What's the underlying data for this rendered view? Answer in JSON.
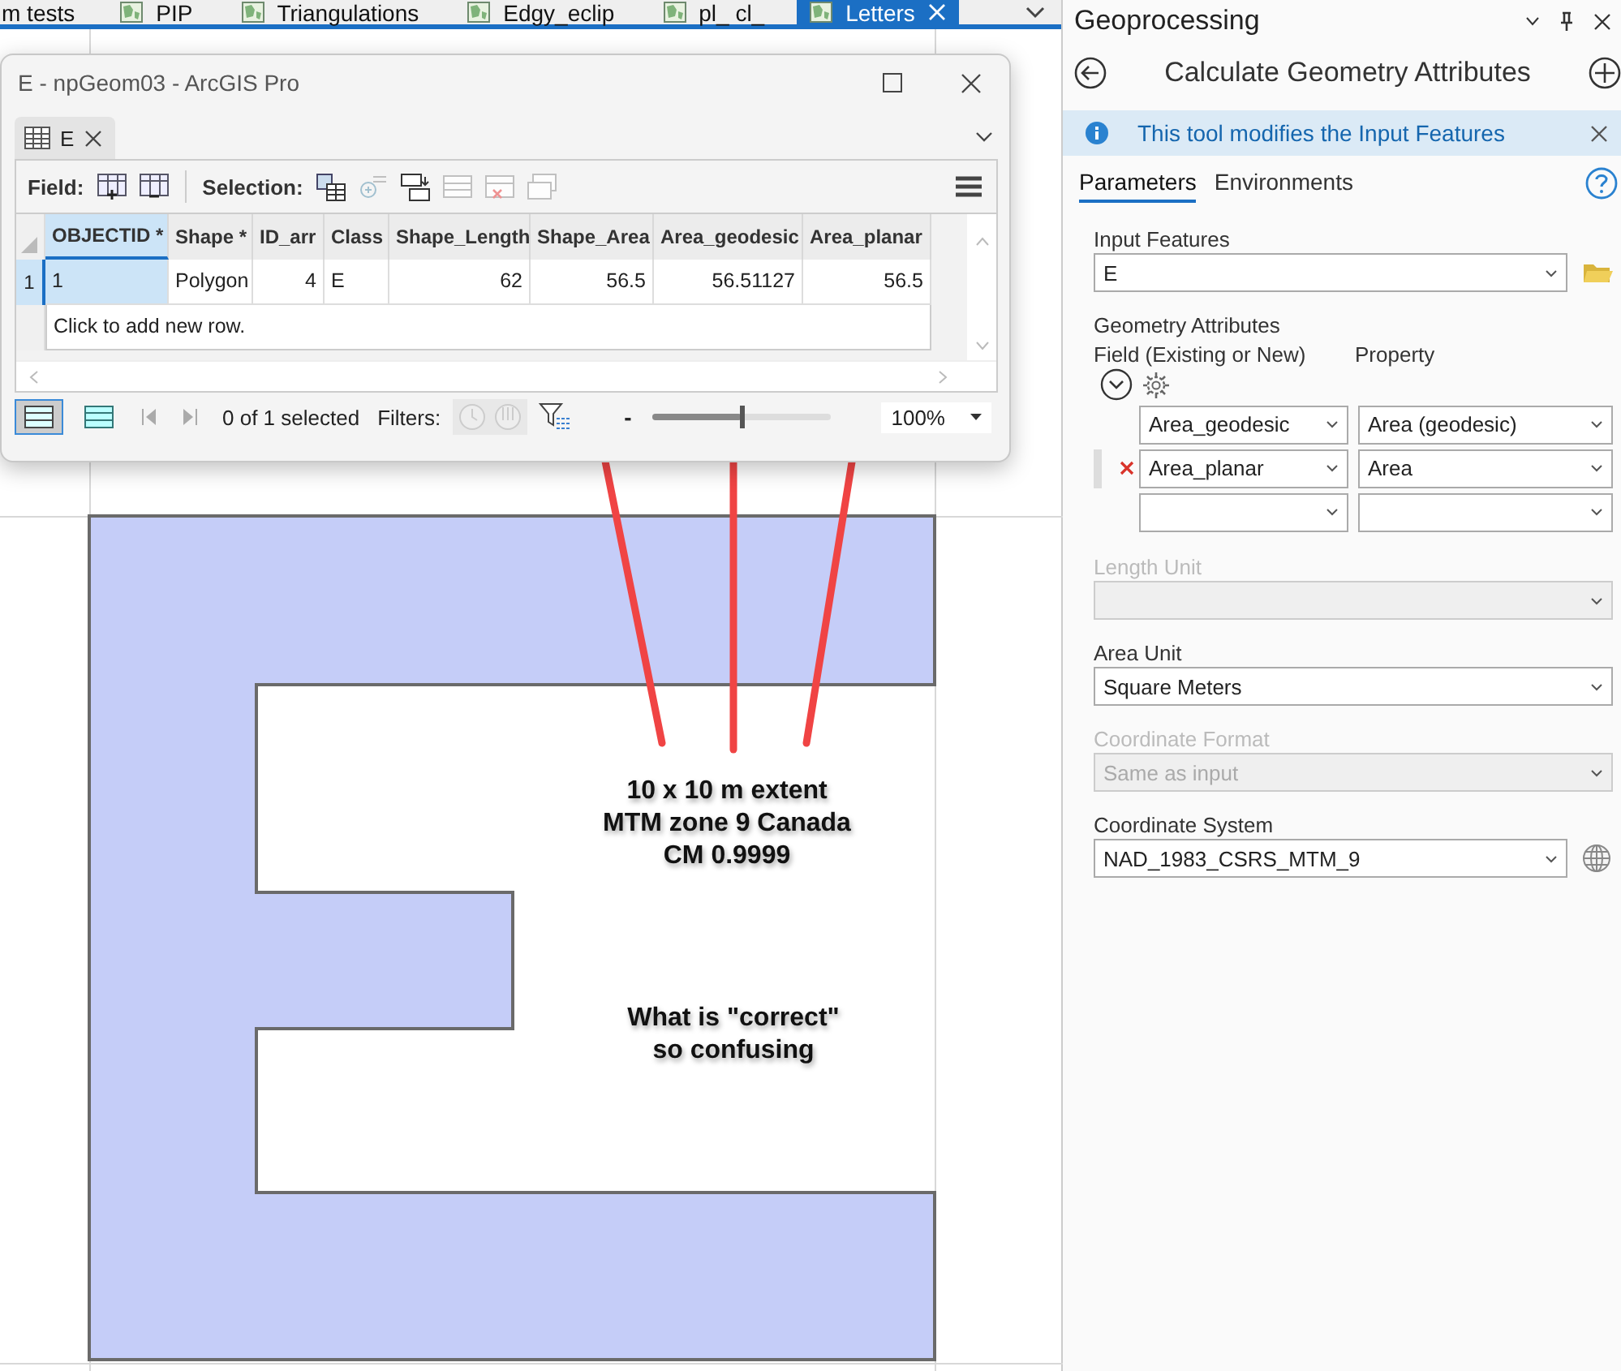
{
  "map_tabs": [
    {
      "label": "m tests",
      "selected": false,
      "icon": false
    },
    {
      "label": "PIP",
      "selected": false,
      "icon": true
    },
    {
      "label": "Triangulations",
      "selected": false,
      "icon": true
    },
    {
      "label": "Edgy_eclip",
      "selected": false,
      "icon": true
    },
    {
      "label": "pl_ cl_",
      "selected": false,
      "icon": true
    },
    {
      "label": "Letters",
      "selected": true,
      "icon": true
    }
  ],
  "table_window": {
    "title": "E - npGeom03 - ArcGIS Pro",
    "tab": "E",
    "field_label": "Field:",
    "selection_label": "Selection:",
    "columns": [
      {
        "label": "OBJECTID *"
      },
      {
        "label": "Shape *"
      },
      {
        "label": "ID_arr"
      },
      {
        "label": "Class"
      },
      {
        "label": "Shape_Length"
      },
      {
        "label": "Shape_Area"
      },
      {
        "label": "Area_geodesic"
      },
      {
        "label": "Area_planar"
      }
    ],
    "rows": [
      {
        "number": "1",
        "focused": true,
        "cells": [
          "1",
          "Polygon",
          "4",
          "E",
          "62",
          "56.5",
          "56.51127",
          "56.5"
        ]
      }
    ],
    "new_row_hint": "Click to add new row.",
    "record_status": "0 of 1 selected",
    "filters_label": "Filters:",
    "zoom_out": "-",
    "zoom_slider": {
      "level": 0.5
    },
    "zoom": "100%"
  },
  "annotations": [
    {
      "lines": [
        "10 x 10 m extent",
        "MTM zone 9 Canada",
        "CM 0.9999"
      ]
    },
    {
      "lines": [
        "What is \"correct\"",
        "so confusing"
      ]
    }
  ],
  "geoprocessing": {
    "title": "Geoprocessing",
    "tool_title": "Calculate Geometry Attributes",
    "info": "This tool modifies the Input Features",
    "tabs": [
      {
        "label": "Parameters",
        "selected": true
      },
      {
        "label": "Environments",
        "selected": false
      }
    ],
    "input_features": {
      "label": "Input Features",
      "value": "E"
    },
    "geometry_attributes": {
      "label": "Geometry Attributes",
      "field_header": "Field (Existing or New)",
      "property_header": "Property",
      "rows": [
        {
          "kind": "filled",
          "field": "Area_geodesic",
          "property": "Area (geodesic)",
          "removable": false
        },
        {
          "kind": "filled",
          "field": "Area_planar",
          "property": "Area",
          "removable": true
        },
        {
          "kind": "blank",
          "removable": false
        }
      ]
    },
    "length_unit": {
      "label": "Length Unit",
      "disabled": true
    },
    "area_unit": {
      "label": "Area Unit",
      "value": "Square Meters",
      "disabled": false
    },
    "coordinate_format": {
      "label": "Coordinate Format",
      "value": "Same as input",
      "disabled": true
    },
    "coordinate_system": {
      "label": "Coordinate System",
      "value": "NAD_1983_CSRS_MTM_9"
    }
  }
}
